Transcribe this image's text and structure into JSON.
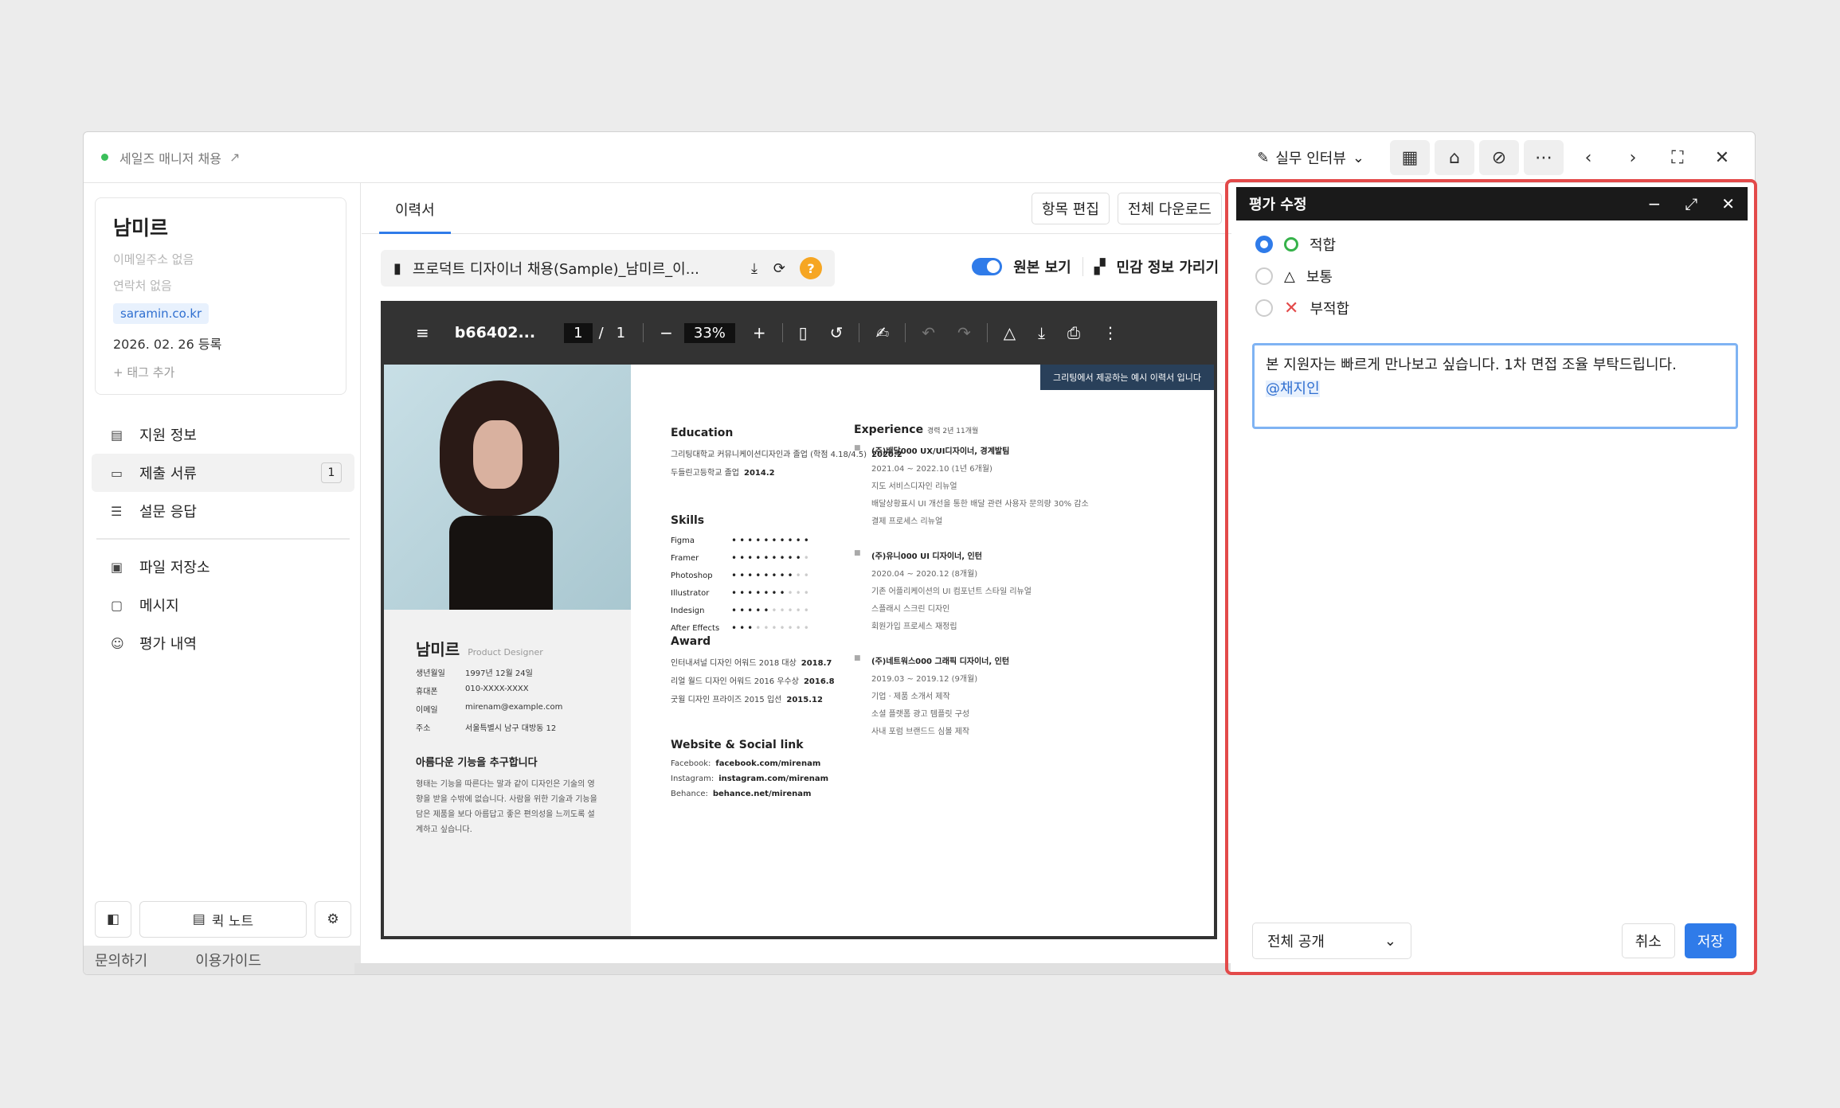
{
  "window": {
    "job_title": "세일즈 매니저 채용",
    "stage": "실무 인터뷰"
  },
  "candidate": {
    "name": "남미르",
    "email": "이메일주소 없음",
    "phone": "연락처 없음",
    "source": "saramin.co.kr",
    "date": "2026. 02. 26",
    "registered": "등록",
    "add_tag": "+ 태그 추가"
  },
  "menu": {
    "items": [
      {
        "label": "지원 정보"
      },
      {
        "label": "제출 서류",
        "count": "1"
      },
      {
        "label": "설문 응답"
      },
      {
        "label": "파일 저장소"
      },
      {
        "label": "메시지"
      },
      {
        "label": "평가 내역"
      }
    ],
    "quick_note": "퀵 노트",
    "faded_inquiry": "문의하기",
    "faded_guide": "이용가이드"
  },
  "docs": {
    "tab": "이력서",
    "edit_items": "항목 편집",
    "download_all": "전체 다운로드",
    "file_name": "프로덕트 디자이너 채용(Sample)_남미르_이...",
    "shield": "?",
    "original_view": "원본 보기",
    "hide_sensitive": "민감 정보 가리기"
  },
  "pdf": {
    "name": "b66402...",
    "page": "1",
    "sep": "/",
    "total": "1",
    "zoom": "33%"
  },
  "resume": {
    "sample_note": "그리팅에서 제공하는 예시 이력서 입니다",
    "name": "남미르",
    "role": "Product Designer",
    "info": [
      {
        "k": "생년월일",
        "v": "1997년 12월 24일"
      },
      {
        "k": "휴대폰",
        "v": "010-XXXX-XXXX"
      },
      {
        "k": "이메일",
        "v": "mirenam@example.com"
      },
      {
        "k": "주소",
        "v": "서울특별시 남구 대방동 12"
      }
    ],
    "intro_title": "아름다운 기능을 추구합니다",
    "intro_text": "형태는 기능을 따른다는 말과 같이 디자인은 기술의 영향을 받을 수밖에 없습니다. 사람을 위한 기술과 기능을 담은 제품을 보다 아름답고 좋은 편의성을 느끼도록 설계하고 싶습니다.",
    "education_title": "Education",
    "education": [
      {
        "t": "그리팅대학교 커뮤니케이션디자인과 졸업 (학점 4.18/4.5)",
        "y": "2020.2"
      },
      {
        "t": "두들린고등학교 졸업",
        "y": "2014.2"
      }
    ],
    "skills_title": "Skills",
    "skills": [
      {
        "name": "Figma",
        "level": 10
      },
      {
        "name": "Framer",
        "level": 9
      },
      {
        "name": "Photoshop",
        "level": 8
      },
      {
        "name": "Illustrator",
        "level": 7
      },
      {
        "name": "Indesign",
        "level": 5
      },
      {
        "name": "After Effects",
        "level": 3
      }
    ],
    "award_title": "Award",
    "awards": [
      {
        "t": "인터내셔널 디자인 어워드 2018 대상",
        "y": "2018.7"
      },
      {
        "t": "리얼 월드 디자인 어워드 2016 우수상",
        "y": "2016.8"
      },
      {
        "t": "굿윌 디자인 프라이즈 2015 입선",
        "y": "2015.12"
      }
    ],
    "web_title": "Website & Social link",
    "links": [
      {
        "k": "Facebook:",
        "v": "facebook.com/mirenam"
      },
      {
        "k": "Instagram:",
        "v": "instagram.com/mirenam"
      },
      {
        "k": "Behance:",
        "v": "behance.net/mirenam"
      }
    ],
    "exp_title": "Experience",
    "exp_sub": "경력 2년 11개월",
    "experience": [
      {
        "head": "(주)배달000 UX/UI디자이너, 경계발팀",
        "lines": [
          "2021.04 ~ 2022.10 (1년 6개월)",
          "지도 서비스디자인 리뉴얼",
          "배달상황표시 UI 개선을 통한 배달 관련 사용자 문의량 30% 감소",
          "결제 프로세스 리뉴얼"
        ]
      },
      {
        "head": "(주)유니000 UI 디자이너, 인턴",
        "lines": [
          "2020.04 ~ 2020.12 (8개월)",
          "기존 어플리케이션의 UI 컴포넌트 스타일 리뉴얼",
          "스플래시 스크린 디자인",
          "회원가입 프로세스 재정립"
        ]
      },
      {
        "head": "(주)네트워스000 그래픽 디자이너, 인턴",
        "lines": [
          "2019.03 ~ 2019.12 (9개월)",
          "기업 · 제품 소개서 제작",
          "소셜 플랫폼 광고 템플릿 구성",
          "사내 포럼 브랜드드 심볼 제작"
        ]
      }
    ]
  },
  "evaluation": {
    "title": "평가 수정",
    "options": [
      {
        "label": "적합",
        "selected": true
      },
      {
        "label": "보통",
        "selected": false
      },
      {
        "label": "부적합",
        "selected": false
      }
    ],
    "comment": "본 지원자는 빠르게 만나보고 싶습니다. 1차 면접 조율 부탁드립니다.",
    "mention": "@채지인",
    "visibility": "전체 공개",
    "cancel": "취소",
    "save": "저장"
  }
}
